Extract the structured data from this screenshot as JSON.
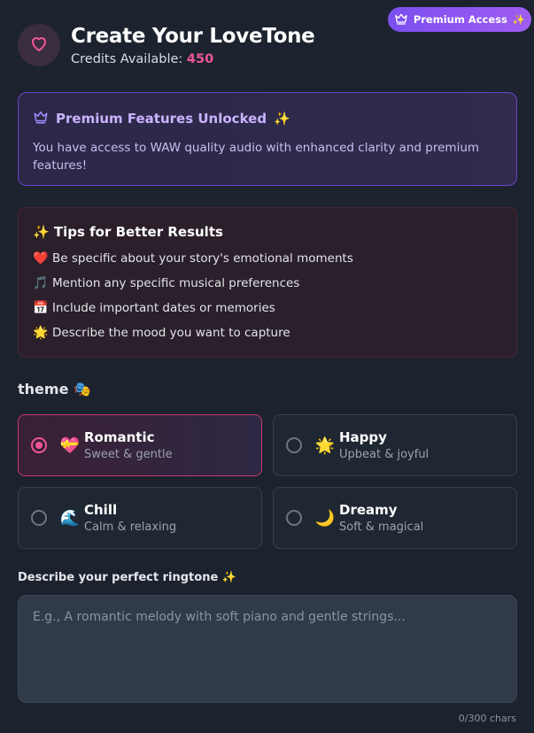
{
  "premium_pill": {
    "label": "Premium Access",
    "sparkle": "✨"
  },
  "header": {
    "title": "Create Your LoveTone",
    "credits_label": "Credits Available:",
    "credits_value": "450"
  },
  "premium_box": {
    "title": "Premium Features Unlocked",
    "sparkle": "✨",
    "text": "You have access to WAW quality audio with enhanced clarity and premium features!"
  },
  "tips": {
    "title": "✨ Tips for Better Results",
    "items": [
      {
        "emoji": "❤️",
        "text": "Be specific about your story's emotional moments"
      },
      {
        "emoji": "🎵",
        "text": "Mention any specific musical preferences"
      },
      {
        "emoji": "📅",
        "text": "Include important dates or memories"
      },
      {
        "emoji": "🌟",
        "text": "Describe the mood you want to capture"
      }
    ]
  },
  "theme": {
    "label": "theme",
    "emoji": "🎭",
    "selected": "Romantic",
    "options": [
      {
        "title": "Romantic",
        "subtitle": "Sweet & gentle",
        "emoji": "💝"
      },
      {
        "title": "Happy",
        "subtitle": "Upbeat & joyful",
        "emoji": "🌟"
      },
      {
        "title": "Chill",
        "subtitle": "Calm & relaxing",
        "emoji": "🌊"
      },
      {
        "title": "Dreamy",
        "subtitle": "Soft & magical",
        "emoji": "🌙"
      }
    ]
  },
  "describe": {
    "label": "Describe your perfect ringtone ✨",
    "value": "",
    "placeholder": "E.g., A romantic melody with soft piano and gentle strings...",
    "char_count": "0/300 chars"
  },
  "colors": {
    "accent_pink": "#f0559a",
    "accent_purple": "#7b4ff0",
    "background": "#1c232e"
  }
}
